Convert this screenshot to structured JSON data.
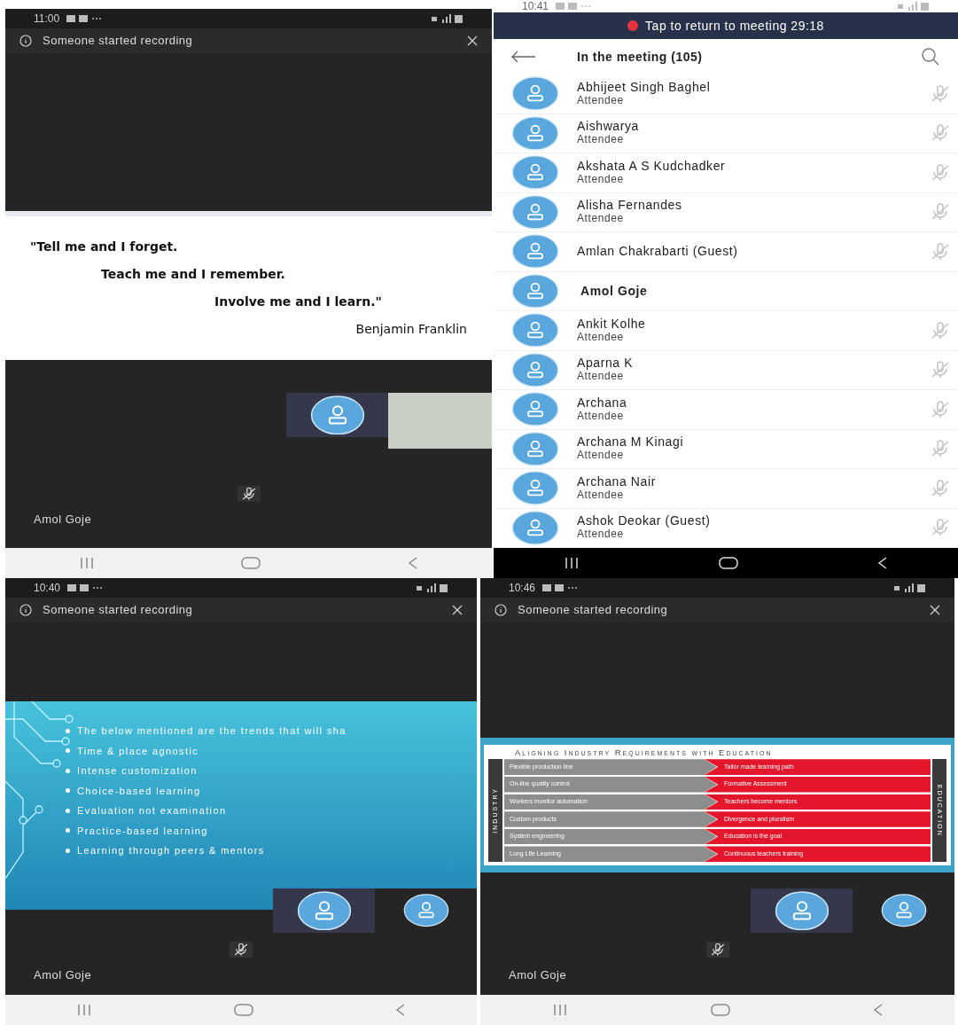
{
  "screens": [
    {
      "kind": "meeting",
      "time": "11:00",
      "banner": "Someone started recording",
      "slide": {
        "kind": "quote",
        "lines": [
          "\"Tell me and I forget.",
          "Teach me and I remember.",
          "Involve me and I learn.\"",
          "Benjamin Franklin"
        ]
      },
      "tiles": [
        {
          "kind": "avatar"
        },
        {
          "kind": "video"
        }
      ],
      "speaker": "Amol Goje"
    },
    {
      "kind": "participants",
      "time": "10:41",
      "return_banner": "Tap to return to meeting 29:18",
      "title": "In the meeting (105)",
      "people": [
        {
          "name": "Abhijeet Singh Baghel",
          "role": "Attendee",
          "muted": true,
          "current_user": false
        },
        {
          "name": "Aishwarya",
          "role": "Attendee",
          "muted": true,
          "current_user": false
        },
        {
          "name": "Akshata A S Kudchadker",
          "role": "Attendee",
          "muted": true,
          "current_user": false
        },
        {
          "name": "Alisha Fernandes",
          "role": "Attendee",
          "muted": true,
          "current_user": false
        },
        {
          "name": "Amlan Chakrabarti (Guest)",
          "muted": true,
          "current_user": false
        },
        {
          "name": "Amol Goje",
          "muted": false,
          "current_user": true
        },
        {
          "name": "Ankit Kolhe",
          "role": "Attendee",
          "muted": true,
          "current_user": false
        },
        {
          "name": "Aparna K",
          "role": "Attendee",
          "muted": true,
          "current_user": false
        },
        {
          "name": "Archana",
          "role": "Attendee",
          "muted": true,
          "current_user": false
        },
        {
          "name": "Archana M Kinagi",
          "role": "Attendee",
          "muted": true,
          "current_user": false
        },
        {
          "name": "Archana Nair",
          "role": "Attendee",
          "muted": true,
          "current_user": false
        },
        {
          "name": "Ashok Deokar (Guest)",
          "role": "Attendee",
          "muted": true,
          "current_user": false
        }
      ]
    },
    {
      "kind": "meeting",
      "time": "10:40",
      "banner": "Someone started recording",
      "slide": {
        "kind": "bullets",
        "lines": [
          "The below mentioned are the trends that will sha",
          "Time & place agnostic",
          "Intense customization",
          "Choice-based learning",
          "Evaluation not examination",
          "Practice-based learning",
          "Learning through peers & mentors"
        ]
      },
      "tiles": [
        {
          "kind": "avatar"
        },
        {
          "kind": "avatar"
        }
      ],
      "speaker": "Amol Goje"
    },
    {
      "kind": "meeting",
      "time": "10:46",
      "banner": "Someone started recording",
      "slide": {
        "kind": "table",
        "title": "Aligning Industry Requirements with Education",
        "left_label": "INDUSTRY",
        "right_label": "EDUCATION",
        "rows": [
          {
            "left": "Flexible production line",
            "right": "Tailor made learning path"
          },
          {
            "left": "On-line quality control",
            "right": "Formative Assessment"
          },
          {
            "left": "Workers monitor automation",
            "right": "Teachers become mentors"
          },
          {
            "left": "Custom products",
            "right": "Divergence and pluralism"
          },
          {
            "left": "System engineering",
            "right": "Education is the goal"
          },
          {
            "left": "Long Life Learning",
            "right": "Continuous teachers training"
          }
        ]
      },
      "tiles": [
        {
          "kind": "avatar"
        },
        {
          "kind": "avatar"
        }
      ],
      "speaker": "Amol Goje"
    }
  ]
}
